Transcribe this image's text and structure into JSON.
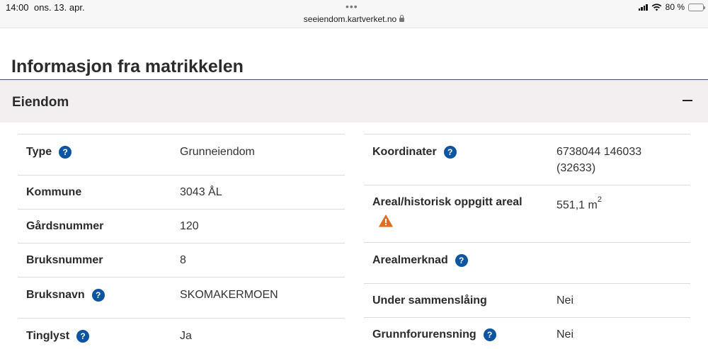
{
  "status_bar": {
    "time": "14:00",
    "date": "ons. 13. apr.",
    "url": "seeiendom.kartverket.no",
    "battery": "80 %",
    "battery_level": 0.8
  },
  "page": {
    "title": "Informasjon fra matrikkelen"
  },
  "section": {
    "title": "Eiendom",
    "collapse_icon": "minus-icon"
  },
  "left_rows": [
    {
      "label": "Type",
      "value": "Grunneiendom",
      "help": true
    },
    {
      "label": "Kommune",
      "value": "3043 ÅL",
      "help": false
    },
    {
      "label": "Gårdsnummer",
      "value": "120",
      "help": false
    },
    {
      "label": "Bruksnummer",
      "value": "8",
      "help": false
    },
    {
      "label": "Bruksnavn",
      "value": "SKOMAKERMOEN",
      "help": true
    },
    {
      "label": "Tinglyst",
      "value": "Ja",
      "help": true
    }
  ],
  "right_rows": [
    {
      "label": "Koordinater",
      "value_line1": "6738044 146033",
      "value_line2": "(32633)",
      "help": true
    },
    {
      "label": "Areal/historisk oppgitt areal",
      "value": "551,1 m",
      "value_sup": "2",
      "warning": true
    },
    {
      "label": "Arealmerknad",
      "value": "",
      "help": true
    },
    {
      "label": "Under sammenslåing",
      "value": "Nei",
      "help": false
    },
    {
      "label": "Grunnforurensning",
      "value": "Nei",
      "help": true
    }
  ],
  "help_glyph": "?",
  "colors": {
    "help_icon": "#0d55a0",
    "warning_icon": "#e07020",
    "section_bg": "#f3eff0"
  }
}
